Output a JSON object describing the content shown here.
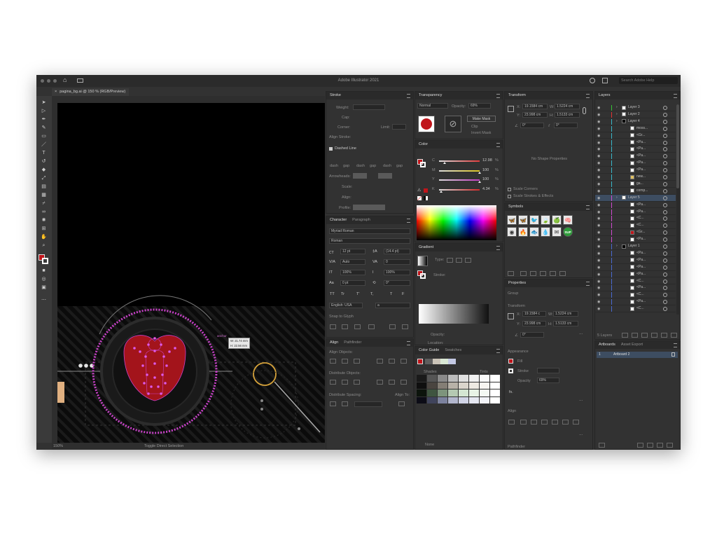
{
  "app": {
    "title": "Adobe Illustrator 2021",
    "search_placeholder": "Search Adobe Help",
    "document_tab": "pagina_bg.ai @ 150 % (RGB/Preview)"
  },
  "status": {
    "zoom": "150%",
    "tool_hint": "Toggle Direct Selection"
  },
  "canvas": {
    "label": "anchor",
    "tooltip_w": "W: 21.74 mm",
    "tooltip_h": "H: 22.56 mm"
  },
  "stroke": {
    "tab": "Stroke",
    "weight_label": "Weight:",
    "cap_label": "Cap:",
    "corner_label": "Corner:",
    "limit_label": "Limit:",
    "align_label": "Align Stroke:",
    "dashed_label": "Dashed Line",
    "dash": [
      "dash",
      "gap",
      "dash",
      "gap",
      "dash",
      "gap"
    ],
    "arrowheads_label": "Arrowheads:",
    "scale_label": "Scale:",
    "align2_label": "Align:",
    "profile_label": "Profile:"
  },
  "transparency": {
    "tab": "Transparency",
    "mode": "Normal",
    "opacity_label": "Opacity:",
    "opacity": "69%",
    "make_mask": "Make Mask",
    "clip": "Clip",
    "invert": "Invert Mask"
  },
  "color": {
    "tab": "Color",
    "channels": [
      {
        "letter": "C",
        "value": "12.98",
        "unit": "%",
        "color": "#e23b3b"
      },
      {
        "letter": "M",
        "value": "100",
        "unit": "%",
        "color": "#d9c21f"
      },
      {
        "letter": "Y",
        "value": "100",
        "unit": "%",
        "color": "#c23ac2"
      },
      {
        "letter": "K",
        "value": "4.34",
        "unit": "%",
        "color": "#cf2a2a"
      }
    ],
    "fill": "#c0151b"
  },
  "character": {
    "tab": "Character",
    "tab2": "Paragraph",
    "font": "Myriad Roman",
    "style": "Roman",
    "size": "12 pt",
    "leading": "(14.4 pt)",
    "kerning": "Auto",
    "tracking": "0",
    "hscale": "100%",
    "vscale": "100%",
    "baseline": "0 pt",
    "rotation": "0°",
    "tt": [
      "TT",
      "Tr",
      "T'",
      "T,",
      "T",
      "F"
    ],
    "language": "English: USA",
    "aa": "a",
    "snap": "Snap to Glyph"
  },
  "align": {
    "tab": "Align",
    "tab2": "Pathfinder",
    "align_objects": "Align Objects:",
    "distribute_objects": "Distribute Objects:",
    "distribute_spacing": "Distribute Spacing:",
    "align_to": "Align To:"
  },
  "gradient": {
    "tab": "Gradient",
    "type_label": "Type:",
    "stroke_label": "Stroke:",
    "opacity_label": "Opacity:",
    "location_label": "Location:"
  },
  "color_guide": {
    "tab": "Color Guide",
    "tab2": "Swatches",
    "shades": "Shades",
    "tints": "Tints",
    "none": "None"
  },
  "transform": {
    "tab": "Transform",
    "x_label": "X:",
    "x": "19.1584 cm",
    "y_label": "Y:",
    "y": "23.998 cm",
    "w_label": "W:",
    "w": "1.5224 cm",
    "h_label": "H:",
    "h": "1.5133 cm",
    "angle": "0°",
    "shear": "0°",
    "empty_msg": "No Shape Properties",
    "scale_corners": "Scale Corners",
    "scale_strokes": "Scale Strokes & Effects"
  },
  "symbols": {
    "tab": "Symbols",
    "items": [
      "moth-symbol",
      "butterfly-symbol",
      "bird-symbol",
      "leaf-symbol",
      "apple-symbol",
      "brain-symbol",
      "target-symbol",
      "fire-symbol",
      "fish-symbol",
      "drop-symbol",
      "mail-symbol",
      "badge-symbol"
    ],
    "badge_text": "SUP"
  },
  "properties": {
    "tab": "Properties",
    "group": "Group",
    "transform": "Transform",
    "x_label": "X:",
    "x": "19.1584 c",
    "y_label": "Y:",
    "y": "23.998 cm",
    "w_label": "W:",
    "w": "1.5224 cm",
    "h_label": "H:",
    "h": "1.5133 cm",
    "angle": "0°",
    "appearance": "Appearance",
    "fill": "Fill",
    "stroke": "Stroke",
    "opacity": "Opacity",
    "opacity_value": "69%",
    "fx": "fx.",
    "align": "Align",
    "pathfinder": "Pathfinder"
  },
  "layers": {
    "tab": "Layers",
    "count": "5 Layers",
    "rows": [
      {
        "name": "Layer 3",
        "indent": 0,
        "color": "#35c435",
        "swatch": "#ffffff"
      },
      {
        "name": "Layer 2",
        "indent": 0,
        "color": "#e23434",
        "swatch": "#ffffff"
      },
      {
        "name": "Layer 4",
        "indent": 0,
        "color": "#3ab7c9",
        "swatch": "#000000"
      },
      {
        "name": "moss...",
        "indent": 2,
        "color": "#3ab7c9",
        "swatch": "#ffffff"
      },
      {
        "name": "<Gr...",
        "indent": 2,
        "color": "#3ab7c9",
        "swatch": "#ffffff"
      },
      {
        "name": "<Pa...",
        "indent": 2,
        "color": "#3ab7c9",
        "swatch": "#ffffff"
      },
      {
        "name": "<Pa...",
        "indent": 2,
        "color": "#3ab7c9",
        "swatch": "#ffffff"
      },
      {
        "name": "<Pa...",
        "indent": 2,
        "color": "#3ab7c9",
        "swatch": "#ffffff"
      },
      {
        "name": "<Pa...",
        "indent": 2,
        "color": "#3ab7c9",
        "swatch": "#ffffff"
      },
      {
        "name": "<Pa...",
        "indent": 2,
        "color": "#3ab7c9",
        "swatch": "#ffffff"
      },
      {
        "name": "new...",
        "indent": 2,
        "color": "#3ab7c9",
        "swatch": "#e0c060"
      },
      {
        "name": "ga...",
        "indent": 2,
        "color": "#3ab7c9",
        "swatch": "#ffffff"
      },
      {
        "name": "comp...",
        "indent": 2,
        "color": "#3ab7c9",
        "swatch": "#ffffff"
      },
      {
        "name": "Layer 5",
        "indent": 0,
        "color": "#d04ad0",
        "swatch": "#ffffff",
        "selected": true
      },
      {
        "name": "<Pa...",
        "indent": 2,
        "color": "#d04ad0",
        "swatch": "#ffffff"
      },
      {
        "name": "<Pa...",
        "indent": 2,
        "color": "#d04ad0",
        "swatch": "#ffffff"
      },
      {
        "name": "<C...",
        "indent": 2,
        "color": "#d04ad0",
        "swatch": "#ffffff"
      },
      {
        "name": "<C...",
        "indent": 2,
        "color": "#d04ad0",
        "swatch": "#ffffff"
      },
      {
        "name": "<Gr...",
        "indent": 2,
        "color": "#d04ad0",
        "swatch": "#c0151b"
      },
      {
        "name": "<Pa...",
        "indent": 2,
        "color": "#d04ad0",
        "swatch": "#ffffff"
      },
      {
        "name": "Layer 1",
        "indent": 0,
        "color": "#4a6ad0",
        "swatch": "#000000"
      },
      {
        "name": "<Pa...",
        "indent": 2,
        "color": "#4a6ad0",
        "swatch": "#ffffff"
      },
      {
        "name": "<Pa...",
        "indent": 2,
        "color": "#4a6ad0",
        "swatch": "#ffffff"
      },
      {
        "name": "<Pa...",
        "indent": 2,
        "color": "#4a6ad0",
        "swatch": "#ffffff"
      },
      {
        "name": "<Pa...",
        "indent": 2,
        "color": "#4a6ad0",
        "swatch": "#ffffff"
      },
      {
        "name": "<C...",
        "indent": 2,
        "color": "#4a6ad0",
        "swatch": "#ffffff"
      },
      {
        "name": "<Pa...",
        "indent": 2,
        "color": "#4a6ad0",
        "swatch": "#ffffff"
      },
      {
        "name": "<C...",
        "indent": 2,
        "color": "#4a6ad0",
        "swatch": "#ffffff"
      },
      {
        "name": "<Pa...",
        "indent": 2,
        "color": "#4a6ad0",
        "swatch": "#ffffff"
      },
      {
        "name": "<C...",
        "indent": 2,
        "color": "#4a6ad0",
        "swatch": "#ffffff"
      }
    ]
  },
  "artboards": {
    "tab": "Artboards",
    "tab2": "Asset Export",
    "index": "1",
    "name": "Artboard 2"
  }
}
